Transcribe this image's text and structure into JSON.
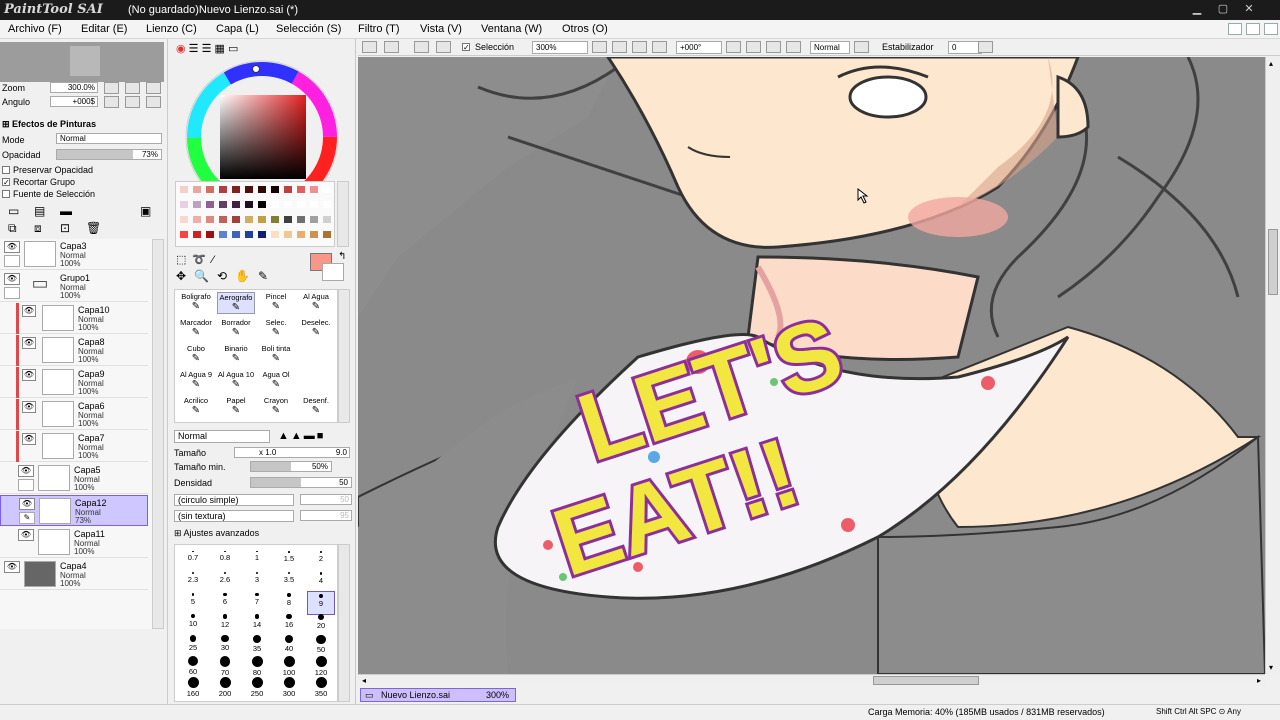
{
  "window": {
    "app_logo": "PaintTool SAI",
    "title": "(No guardado)Nuevo Lienzo.sai (*)"
  },
  "menu": [
    "Archivo (F)",
    "Editar (E)",
    "Lienzo (C)",
    "Capa (L)",
    "Selección (S)",
    "Filtro (T)",
    "Vista (V)",
    "Ventana (W)",
    "Otros (O)"
  ],
  "navigator": {
    "zoom_label": "Zoom",
    "zoom_value": "300.0%",
    "angle_label": "Angulo",
    "angle_value": "+000$"
  },
  "layer_props": {
    "effects_label": "Efectos de Pinturas",
    "mode_label": "Mode",
    "mode_value": "Normal",
    "opacity_label": "Opacidad",
    "opacity_value": "73%",
    "opacity_level": 0.73,
    "preserve_opacity": "Preservar Opacidad",
    "clip_group": "Recortar Grupo",
    "selection_source": "Fuente de Selección"
  },
  "layers": [
    {
      "name": "Capa3",
      "mode": "Normal",
      "opacity": "100%"
    },
    {
      "name": "Grupo1",
      "mode": "Normal",
      "opacity": "100%"
    },
    {
      "name": "Capa10",
      "mode": "Normal",
      "opacity": "100%"
    },
    {
      "name": "Capa8",
      "mode": "Normal",
      "opacity": "100%"
    },
    {
      "name": "Capa9",
      "mode": "Normal",
      "opacity": "100%"
    },
    {
      "name": "Capa6",
      "mode": "Normal",
      "opacity": "100%"
    },
    {
      "name": "Capa7",
      "mode": "Normal",
      "opacity": "100%"
    },
    {
      "name": "Capa5",
      "mode": "Normal",
      "opacity": "100%"
    },
    {
      "name": "Capa12",
      "mode": "Normal",
      "opacity": "73%"
    },
    {
      "name": "Capa11",
      "mode": "Normal",
      "opacity": "100%"
    },
    {
      "name": "Capa4",
      "mode": "Normal",
      "opacity": "100%"
    }
  ],
  "tools": [
    [
      "Boligrafo",
      "Aerografo",
      "Pincel",
      "Al Agua"
    ],
    [
      "Marcador",
      "Borrador",
      "Selec.",
      "Deselec."
    ],
    [
      "Cubo",
      "Binario",
      "Boli tinta",
      ""
    ],
    [
      "Al Agua 9",
      "Al Agua 10",
      "Agua Ol",
      ""
    ],
    [
      "Acrilico",
      "Papel",
      "Crayon",
      "Desenf."
    ]
  ],
  "brush_settings": {
    "blend_mode": "Normal",
    "size_label": "Tamaño",
    "size_mult": "x 1.0",
    "size_value": "9.0",
    "min_size_label": "Tamaño min.",
    "min_size_value": "50%",
    "min_size_level": 0.5,
    "density_label": "Densidad",
    "density_value": "50",
    "density_level": 0.5,
    "shape": "(circulo simple)",
    "shape_value": "50",
    "texture": "(sin textura)",
    "texture_value": "95",
    "advanced_label": "Ajustes avanzados"
  },
  "brush_sizes": [
    "0.7",
    "0.8",
    "1",
    "1.5",
    "2",
    "2.3",
    "2.6",
    "3",
    "3.5",
    "4",
    "5",
    "6",
    "7",
    "8",
    "9",
    "10",
    "12",
    "14",
    "16",
    "20",
    "25",
    "30",
    "35",
    "40",
    "50",
    "60",
    "70",
    "80",
    "100",
    "120",
    "160",
    "200",
    "250",
    "300",
    "350"
  ],
  "selected_brush_size": "9",
  "canvas_toolbar": {
    "selection_label": "Selección",
    "zoom": "300%",
    "angle": "+000°",
    "mode": "Normal",
    "stabilizer_label": "Estabilizador",
    "stabilizer_value": "0"
  },
  "doc_tab": {
    "name": "Nuevo Lienzo.sai",
    "zoom": "300%"
  },
  "status": {
    "memory": "Carga Memoria: 40% (185MB usados / 831MB reservados)",
    "keys": "Shift Ctrl Alt SPC ⊙ Any"
  },
  "artwork": {
    "shirt_text_line1": "LET'S",
    "shirt_text_line2": "EAT!!"
  },
  "colors": {
    "current_color": "#f8968a",
    "accent_selected": "#7b5cff",
    "canvas_bg": "#8a8a8a",
    "skin": "#fde7cf",
    "shirt_text": "#f2e640",
    "shirt_text_outline": "#8d2f9b"
  }
}
